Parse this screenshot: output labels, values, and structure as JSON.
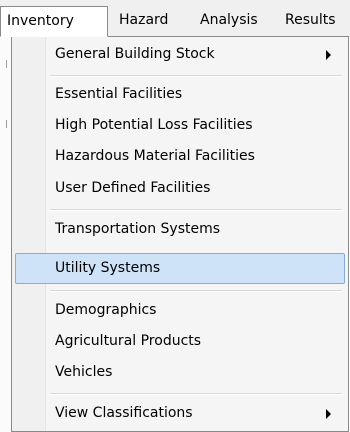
{
  "menubar": {
    "items": [
      {
        "label": "Inventory",
        "active": true
      },
      {
        "label": "Hazard",
        "active": false
      },
      {
        "label": "Analysis",
        "active": false
      },
      {
        "label": "Results",
        "active": false
      }
    ]
  },
  "dropdown": {
    "items": [
      {
        "label": "General Building Stock",
        "has_submenu": true
      },
      {
        "label": "Essential Facilities",
        "has_submenu": false
      },
      {
        "label": "High Potential Loss Facilities",
        "has_submenu": false
      },
      {
        "label": "Hazardous Material Facilities",
        "has_submenu": false
      },
      {
        "label": "User Defined Facilities",
        "has_submenu": false
      },
      {
        "label": "Transportation Systems",
        "has_submenu": false
      },
      {
        "label": "Utility Systems",
        "has_submenu": false,
        "highlighted": true
      },
      {
        "label": "Demographics",
        "has_submenu": false
      },
      {
        "label": "Agricultural Products",
        "has_submenu": false
      },
      {
        "label": "Vehicles",
        "has_submenu": false
      },
      {
        "label": "View Classifications",
        "has_submenu": true
      }
    ]
  },
  "colors": {
    "highlight_fill": "#cfe3f8",
    "highlight_border": "#84acdd",
    "menu_background": "#f5f5f5",
    "menubar_background": "#f0f0f0"
  }
}
